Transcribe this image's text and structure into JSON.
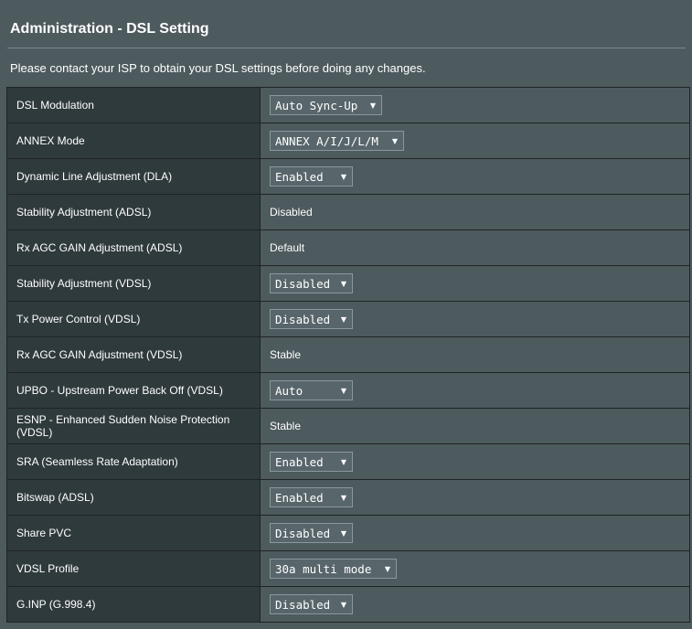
{
  "page": {
    "title": "Administration - DSL Setting",
    "notice": "Please contact your ISP to obtain your DSL settings before doing any changes."
  },
  "settings": {
    "dsl_modulation": {
      "label": "DSL Modulation",
      "value": "Auto Sync-Up"
    },
    "annex_mode": {
      "label": "ANNEX Mode",
      "value": "ANNEX A/I/J/L/M"
    },
    "dla": {
      "label": "Dynamic Line Adjustment (DLA)",
      "value": "Enabled"
    },
    "stability_adsl": {
      "label": "Stability Adjustment (ADSL)",
      "value": "Disabled"
    },
    "rx_agc_adsl": {
      "label": "Rx AGC GAIN Adjustment (ADSL)",
      "value": "Default"
    },
    "stability_vdsl": {
      "label": "Stability Adjustment (VDSL)",
      "value": "Disabled"
    },
    "tx_power_vdsl": {
      "label": "Tx Power Control (VDSL)",
      "value": "Disabled"
    },
    "rx_agc_vdsl": {
      "label": "Rx AGC GAIN Adjustment (VDSL)",
      "value": "Stable"
    },
    "upbo": {
      "label": "UPBO - Upstream Power Back Off (VDSL)",
      "value": "Auto"
    },
    "esnp": {
      "label": "ESNP - Enhanced Sudden Noise Protection (VDSL)",
      "value": "Stable"
    },
    "sra": {
      "label": "SRA (Seamless Rate Adaptation)",
      "value": "Enabled"
    },
    "bitswap": {
      "label": "Bitswap (ADSL)",
      "value": "Enabled"
    },
    "share_pvc": {
      "label": "Share PVC",
      "value": "Disabled"
    },
    "vdsl_profile": {
      "label": "VDSL Profile",
      "value": "30a multi mode"
    },
    "ginp": {
      "label": "G.INP (G.998.4)",
      "value": "Disabled"
    }
  },
  "icons": {
    "dropdown": "chevron-down-icon"
  },
  "colors": {
    "background": "#4d5a5e",
    "label_cell": "#2f3a3d",
    "select_bg": "#58666b",
    "text": "#ffffff"
  }
}
